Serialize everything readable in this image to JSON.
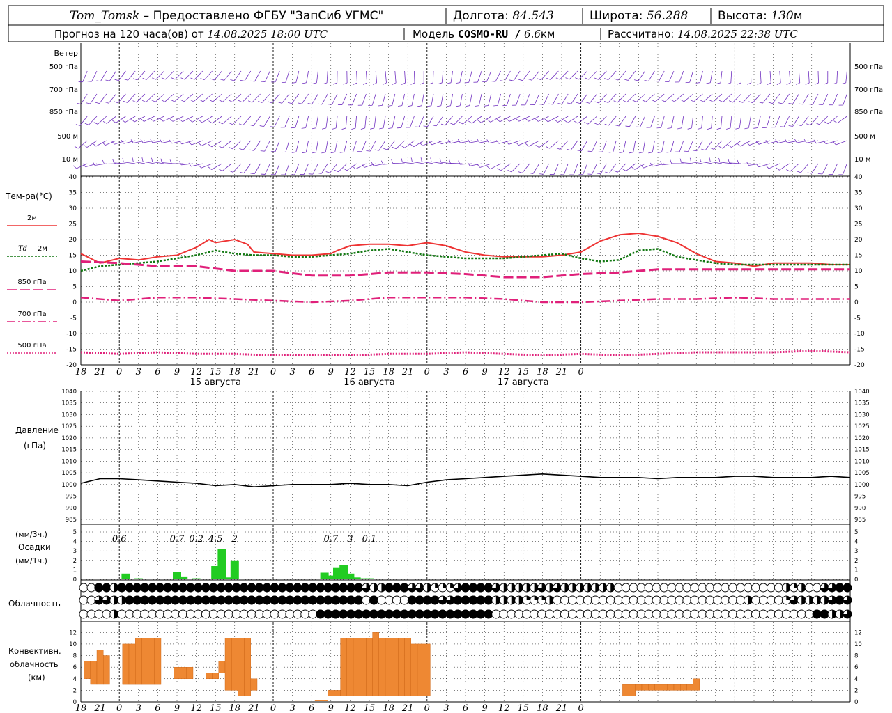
{
  "header": {
    "station": "Tom_Tomsk",
    "dash": " – ",
    "provider": "Предоставлено ФГБУ \"ЗапСиб УГМС\"",
    "lon_label": "Долгота:",
    "lon_value": "84.543",
    "lat_label": "Широта:",
    "lat_value": "56.288",
    "alt_label": "Высота:",
    "alt_value": "130",
    "alt_unit": "м",
    "forecast_prefix": "Прогноз на 120 часа(ов) от",
    "forecast_time": "14.08.2025 18:00 UTC",
    "model_label": "Модель",
    "model_name": "COSMO-RU /",
    "model_res": "6.6",
    "model_res_unit": "км",
    "calc_label": "Рассчитано:",
    "calc_time": "14.08.2025 22:38 UTC"
  },
  "wind_panel": {
    "title": "Ветер",
    "levels": [
      "500 гПа",
      "700 гПа",
      "850 гПа",
      "500 м",
      "10 м"
    ],
    "color": "#7030c0"
  },
  "temp_panel": {
    "title": "Тем-ра(°С)",
    "legend": [
      {
        "label": "2м",
        "italic_prefix": "",
        "color": "#ee3333",
        "style": "solid"
      },
      {
        "label": "2м",
        "italic_prefix": "Td",
        "color": "#117711",
        "style": "dotted"
      },
      {
        "label": "850 гПа",
        "italic_prefix": "",
        "color": "#e0207a",
        "style": "dashed"
      },
      {
        "label": "700 гПа",
        "italic_prefix": "",
        "color": "#e0207a",
        "style": "dashdot"
      },
      {
        "label": "500 гПа",
        "italic_prefix": "",
        "color": "#e0207a",
        "style": "dot"
      }
    ],
    "yticks": [
      "40",
      "35",
      "30",
      "25",
      "20",
      "15",
      "10",
      "5",
      "0",
      "-5",
      "-10",
      "-15",
      "-20"
    ]
  },
  "time_axis": {
    "ticks": [
      "18",
      "21",
      "0",
      "3",
      "6",
      "9",
      "12",
      "15",
      "18",
      "21",
      "0",
      "3",
      "6",
      "9",
      "12",
      "15",
      "18",
      "21",
      "0",
      "3",
      "6",
      "9",
      "12",
      "15",
      "18",
      "21",
      "0"
    ],
    "dates": [
      "15 августа",
      "16 августа",
      "17 августа"
    ]
  },
  "pressure_panel": {
    "title1": "Давление",
    "title2": "(гПа)",
    "yticks": [
      "1040",
      "1035",
      "1030",
      "1025",
      "1020",
      "1015",
      "1010",
      "1005",
      "1000",
      "995",
      "990",
      "985"
    ]
  },
  "precip_panel": {
    "title1": "(мм/3ч.)",
    "title2": "Осадки",
    "title3": "(мм/1ч.)",
    "yticks": [
      "5",
      "4",
      "3",
      "2",
      "1",
      "0"
    ],
    "labels": [
      {
        "h": 6,
        "text": "0.6"
      },
      {
        "h": 15,
        "text": "0.7"
      },
      {
        "h": 18,
        "text": "0.2"
      },
      {
        "h": 21,
        "text": "4.5"
      },
      {
        "h": 24,
        "text": "2"
      },
      {
        "h": 39,
        "text": "0.7"
      },
      {
        "h": 42,
        "text": "3"
      },
      {
        "h": 45,
        "text": "0.1"
      }
    ]
  },
  "cloud_panel": {
    "title": "Облачность"
  },
  "conv_panel": {
    "title1": "Конвективн.",
    "title2": "облачность",
    "title3": "(км)",
    "yticks": [
      "12",
      "10",
      "8",
      "6",
      "4",
      "2",
      "0"
    ]
  },
  "chart_data": [
    {
      "type": "line",
      "title": "Тем-ра(°С)",
      "x_unit": "hours from 14.08.2025 18:00 UTC",
      "ylim": [
        -20,
        40
      ],
      "series": [
        {
          "name": "2м",
          "x": [
            0,
            3,
            6,
            9,
            12,
            15,
            18,
            20,
            21,
            24,
            26,
            27,
            30,
            33,
            36,
            39,
            40,
            42,
            45,
            48,
            51,
            54,
            57,
            60,
            63,
            66,
            69,
            72,
            75,
            78,
            81,
            84,
            87,
            90,
            93,
            96,
            99,
            102,
            105,
            108,
            111,
            114,
            117,
            120
          ],
          "values": [
            15.5,
            12.5,
            14,
            13.5,
            14.5,
            15,
            17.5,
            20,
            19,
            20,
            18.5,
            16,
            15.5,
            15,
            15,
            15.5,
            16.5,
            18,
            18.5,
            18.5,
            18,
            19,
            18,
            16,
            15,
            14.5,
            14.5,
            14.5,
            15,
            16,
            19.5,
            21.5,
            22,
            21,
            19,
            15.5,
            13,
            12.5,
            11.5,
            12.5,
            12.5,
            12.5,
            12,
            12
          ]
        },
        {
          "name": "Td 2м",
          "x": [
            0,
            3,
            6,
            9,
            12,
            15,
            18,
            21,
            24,
            27,
            30,
            33,
            36,
            39,
            42,
            45,
            48,
            51,
            54,
            57,
            60,
            63,
            66,
            69,
            72,
            75,
            78,
            81,
            84,
            87,
            90,
            93,
            96,
            99,
            102,
            105,
            108,
            111,
            114,
            117,
            120
          ],
          "values": [
            10,
            11.5,
            12,
            12.5,
            13,
            14,
            15,
            16.5,
            15.5,
            15,
            15,
            14.5,
            14.5,
            15,
            15.5,
            16.5,
            17,
            16,
            15,
            14.5,
            14,
            14,
            14,
            14.5,
            15,
            15.5,
            14,
            13,
            13.5,
            16.5,
            17,
            14.5,
            13.5,
            12.5,
            12,
            12,
            12,
            12,
            12,
            12,
            12
          ]
        },
        {
          "name": "850 гПа",
          "x": [
            0,
            6,
            12,
            18,
            24,
            30,
            36,
            42,
            48,
            54,
            60,
            66,
            72,
            78,
            84,
            90,
            96,
            102,
            108,
            114,
            120
          ],
          "values": [
            13,
            12.5,
            11.5,
            11.5,
            10,
            10,
            8.5,
            8.5,
            9.5,
            9.5,
            9,
            8,
            8,
            9,
            9.5,
            10.5,
            10.5,
            10.5,
            10.5,
            10.5,
            10.5
          ]
        },
        {
          "name": "700 гПа",
          "x": [
            0,
            6,
            12,
            18,
            24,
            30,
            36,
            42,
            48,
            54,
            60,
            66,
            72,
            78,
            84,
            90,
            96,
            102,
            108,
            114,
            120
          ],
          "values": [
            1.5,
            0.5,
            1.5,
            1.5,
            1,
            0.5,
            0,
            0.5,
            1.5,
            1.5,
            1.5,
            1,
            0,
            0,
            0.5,
            1,
            1,
            1.5,
            1,
            1,
            1
          ]
        },
        {
          "name": "500 гПа",
          "x": [
            0,
            6,
            12,
            18,
            24,
            30,
            36,
            42,
            48,
            54,
            60,
            66,
            72,
            78,
            84,
            90,
            96,
            102,
            108,
            114,
            120
          ],
          "values": [
            -16,
            -16.5,
            -16,
            -16.5,
            -16.5,
            -17,
            -17,
            -17,
            -16.5,
            -16.5,
            -16,
            -16.5,
            -17,
            -16.5,
            -17,
            -16.5,
            -16,
            -16,
            -16,
            -15.5,
            -16
          ]
        }
      ]
    },
    {
      "type": "line",
      "title": "Давление",
      "x_unit": "hours from 14.08.2025 18:00 UTC",
      "ylim": [
        985,
        1040
      ],
      "series": [
        {
          "name": "Давление",
          "x": [
            0,
            3,
            6,
            9,
            12,
            15,
            18,
            21,
            24,
            27,
            30,
            33,
            36,
            39,
            42,
            45,
            48,
            51,
            54,
            57,
            60,
            63,
            66,
            69,
            72,
            75,
            78,
            81,
            84,
            87,
            90,
            93,
            96,
            99,
            102,
            105,
            108,
            111,
            114,
            117,
            120
          ],
          "values": [
            1000.5,
            1002.5,
            1002.5,
            1002,
            1001.5,
            1001,
            1000.5,
            999.5,
            1000,
            999,
            999.5,
            1000,
            1000,
            1000,
            1000.5,
            1000,
            1000,
            999.5,
            1001,
            1002,
            1002.5,
            1003,
            1003.5,
            1004,
            1004.5,
            1004,
            1003.5,
            1003,
            1003,
            1003,
            1002.5,
            1003,
            1003,
            1003,
            1003.5,
            1003.5,
            1003,
            1003,
            1003,
            1003.5,
            1003
          ]
        }
      ]
    },
    {
      "type": "bar",
      "title": "Осадки",
      "x_unit": "hours from 14.08.2025 18:00 UTC",
      "ylim": [
        0,
        5
      ],
      "x": [
        7,
        9,
        15,
        16,
        18,
        21,
        22,
        23,
        24,
        38,
        39,
        40,
        41,
        42,
        43,
        44,
        45
      ],
      "values": [
        0.6,
        0.1,
        0.8,
        0.3,
        0.1,
        1.4,
        3.2,
        0.2,
        2.0,
        0.7,
        0.4,
        1.2,
        1.5,
        0.6,
        0.2,
        0.1,
        0.1
      ]
    },
    {
      "type": "bar",
      "title": "Конвективн. облачность (км)",
      "x_unit": "hours from 14.08.2025 18:00 UTC",
      "ylim": [
        0,
        13
      ],
      "x": [
        1,
        2,
        3,
        4,
        5,
        6,
        7,
        8,
        9,
        10,
        11,
        12,
        15,
        16,
        17,
        18,
        20,
        21,
        22,
        23,
        24,
        25,
        26,
        27,
        28,
        37,
        38,
        39,
        40,
        41,
        42,
        43,
        44,
        45,
        46,
        47,
        48,
        49,
        50,
        51,
        52,
        53,
        54,
        85,
        86,
        87,
        88,
        89,
        90,
        91,
        92,
        93,
        94,
        95,
        96
      ],
      "bottom": [
        4,
        3,
        3,
        3,
        4,
        4,
        3,
        3,
        3,
        3,
        3,
        3,
        4,
        4,
        4,
        4,
        4,
        4,
        5,
        2,
        2,
        1,
        1,
        2,
        3,
        0,
        0,
        1,
        1,
        1,
        1,
        1,
        1,
        1,
        1,
        1,
        1,
        1,
        1,
        1,
        1,
        1,
        1,
        1,
        1,
        2,
        2,
        2,
        2,
        2,
        2,
        2,
        2,
        2,
        2
      ],
      "top": [
        7,
        7,
        9,
        8,
        4,
        4,
        10,
        10,
        11,
        11,
        11,
        11,
        6,
        6,
        6,
        4,
        5,
        5,
        7,
        11,
        11,
        11,
        11,
        4,
        3,
        0,
        0,
        2,
        2,
        11,
        11,
        11,
        11,
        11,
        12,
        11,
        11,
        11,
        11,
        11,
        10,
        10,
        10,
        3,
        3,
        3,
        3,
        3,
        3,
        3,
        3,
        3,
        3,
        3,
        4
      ]
    },
    {
      "type": "heatmap",
      "title": "Облачность",
      "x_unit": "hours from 14.08.2025 18:00 UTC (3h step columns, 3 layers: upper/middle/lower)",
      "upper": [
        0,
        0,
        8,
        8,
        4,
        8,
        8,
        8,
        8,
        8,
        8,
        8,
        8,
        8,
        8,
        8,
        8,
        8,
        8,
        8,
        8,
        8,
        8,
        8,
        8,
        8,
        8,
        8,
        8,
        8,
        8,
        8,
        8,
        8,
        8,
        8,
        8,
        6,
        4,
        4,
        8,
        8,
        8,
        6,
        6,
        4,
        2,
        2,
        2,
        6,
        8,
        8,
        8,
        8,
        6,
        4,
        4,
        4,
        4,
        4,
        6,
        4,
        6,
        4,
        4,
        4,
        4,
        4,
        4,
        4,
        0,
        0,
        0,
        0,
        0,
        0,
        0,
        0,
        0,
        0,
        0,
        0,
        0,
        0,
        0,
        0,
        0,
        0,
        0,
        0,
        0,
        0,
        4,
        2,
        4,
        0,
        0,
        6,
        6,
        8,
        8
      ],
      "middle": [
        0,
        0,
        6,
        6,
        4,
        4,
        8,
        8,
        8,
        8,
        8,
        8,
        8,
        8,
        8,
        8,
        8,
        8,
        8,
        8,
        8,
        8,
        8,
        8,
        8,
        8,
        8,
        8,
        8,
        8,
        8,
        8,
        8,
        8,
        8,
        8,
        8,
        0,
        8,
        0,
        0,
        0,
        0,
        8,
        8,
        8,
        8,
        6,
        6,
        8,
        8,
        8,
        8,
        8,
        4,
        4,
        4,
        4,
        2,
        2,
        2,
        4,
        0,
        0,
        0,
        0,
        0,
        0,
        0,
        0,
        0,
        0,
        0,
        0,
        0,
        0,
        0,
        0,
        0,
        0,
        0,
        0,
        0,
        0,
        0,
        0,
        0,
        4,
        0,
        0,
        0,
        0,
        2,
        6,
        4,
        4,
        4,
        4,
        6,
        8,
        6
      ],
      "lower": [
        0,
        0,
        0,
        0,
        4,
        0,
        0,
        0,
        0,
        0,
        0,
        0,
        0,
        0,
        0,
        0,
        0,
        0,
        0,
        0,
        0,
        0,
        0,
        0,
        0,
        0,
        0,
        0,
        0,
        0,
        0,
        8,
        8,
        8,
        8,
        8,
        8,
        8,
        8,
        8,
        8,
        8,
        8,
        8,
        8,
        8,
        8,
        8,
        8,
        8,
        8,
        8,
        8,
        8,
        0,
        0,
        0,
        0,
        0,
        0,
        0,
        0,
        0,
        0,
        0,
        0,
        0,
        0,
        0,
        0,
        0,
        0,
        0,
        0,
        0,
        0,
        0,
        0,
        0,
        0,
        0,
        0,
        0,
        0,
        0,
        0,
        0,
        0,
        0,
        0,
        0,
        0,
        0,
        0,
        0,
        0,
        8,
        8,
        4,
        4,
        6
      ]
    }
  ]
}
